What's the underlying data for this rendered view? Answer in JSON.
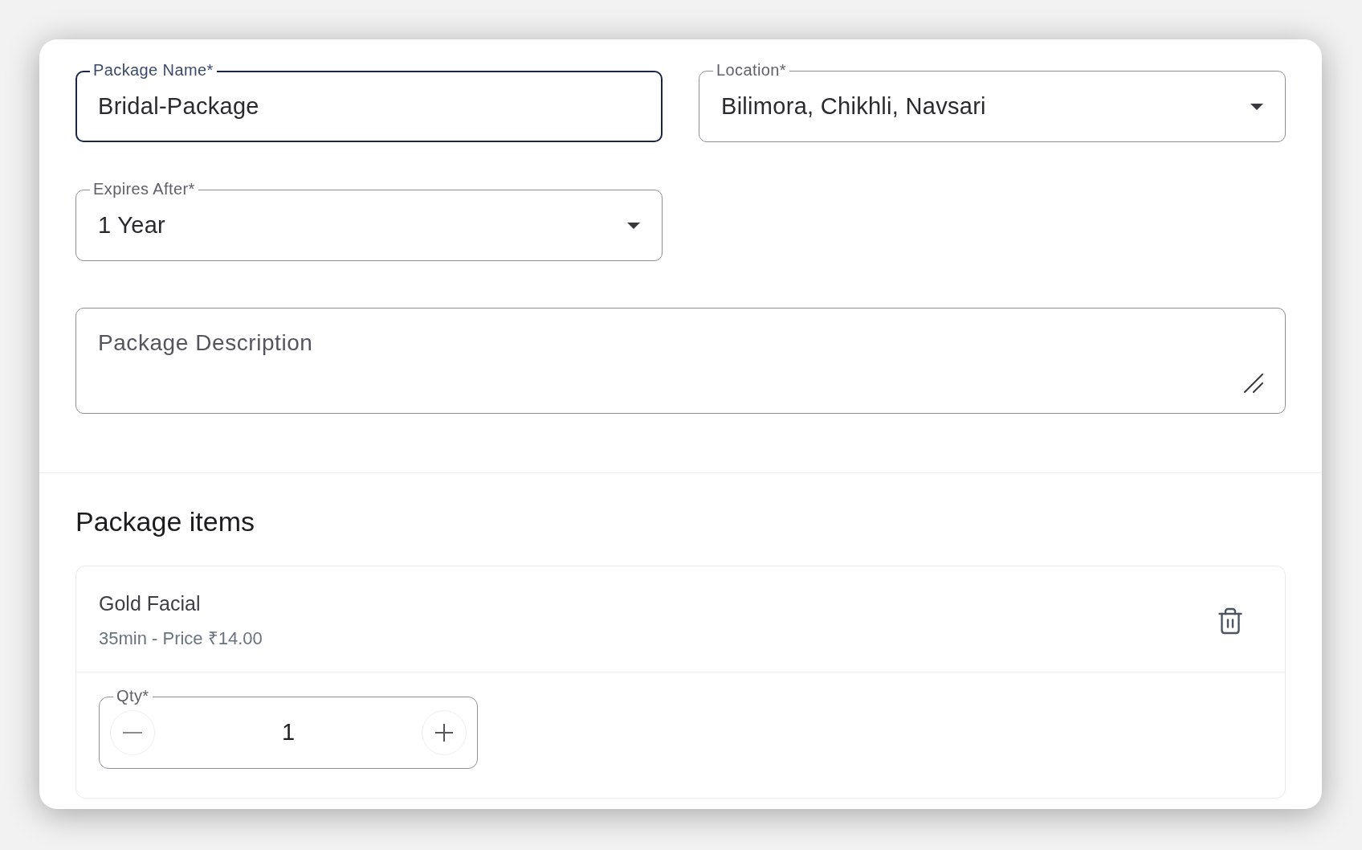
{
  "form": {
    "fields": [
      {
        "kind": "text",
        "label": "Package Name*",
        "value": "Bridal-Package",
        "focused": true
      },
      {
        "kind": "select",
        "label": "Location*",
        "value": "Bilimora, Chikhli, Navsari",
        "focused": false
      },
      {
        "kind": "select",
        "label": "Expires After*",
        "value": "1 Year",
        "focused": false
      }
    ],
    "description": {
      "placeholder": "Package Description"
    }
  },
  "package_items": {
    "title": "Package items",
    "items": [
      {
        "name": "Gold Facial",
        "details": "35min - Price ₹14.00",
        "qty": {
          "label": "Qty*",
          "value": "1"
        }
      }
    ]
  }
}
